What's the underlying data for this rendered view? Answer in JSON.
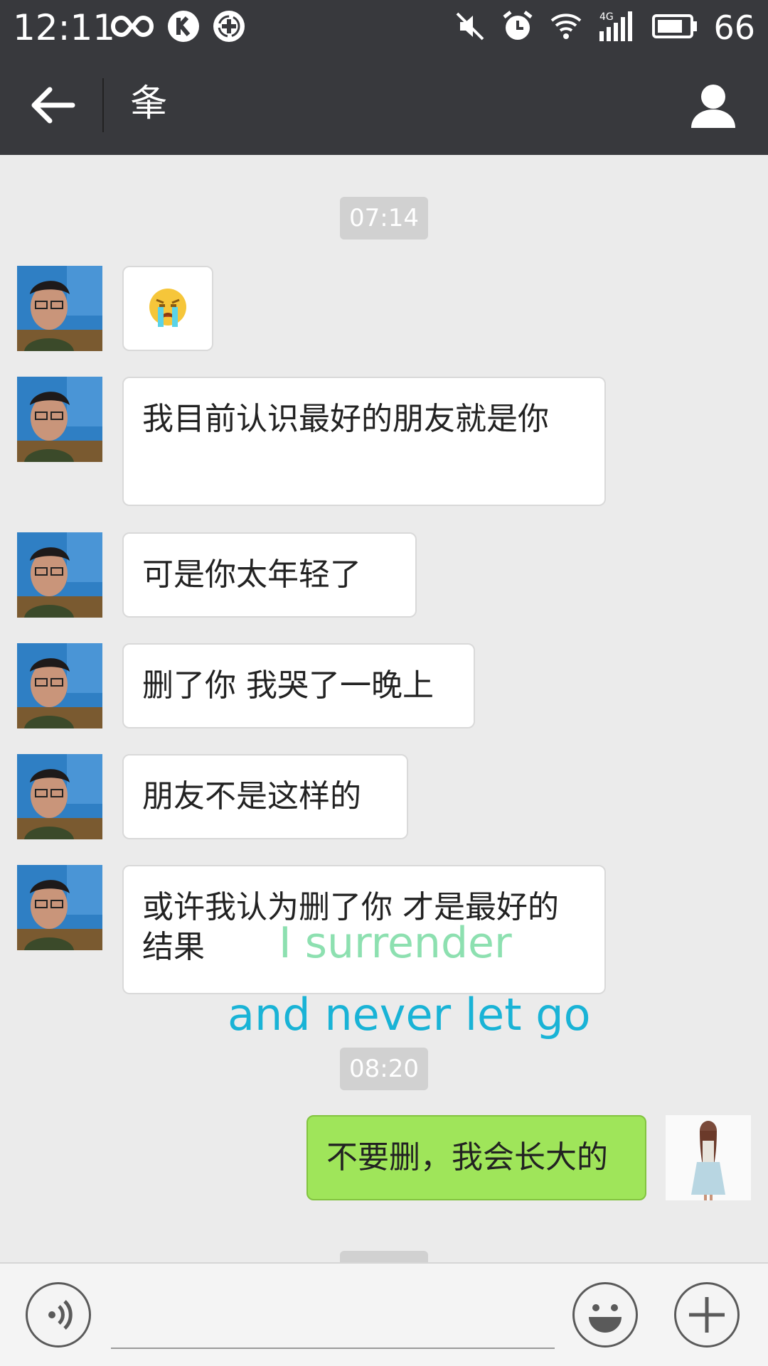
{
  "status_bar": {
    "time": "12:11",
    "battery": "66",
    "network": "4G"
  },
  "header": {
    "title": "夆"
  },
  "timestamps": [
    "07:14",
    "08:20"
  ],
  "messages": [
    {
      "from": "contact",
      "type": "emoji",
      "icon": "crying-face-emoji"
    },
    {
      "from": "contact",
      "text": " 我目前认识最好的朋友就是你"
    },
    {
      "from": "contact",
      "text": "可是你太年轻了"
    },
    {
      "from": "contact",
      "text": "删了你 我哭了一晚上"
    },
    {
      "from": "contact",
      "text": "朋友不是这样的"
    },
    {
      "from": "contact",
      "text": "或许我认为删了你 才是最好的结果"
    },
    {
      "from": "me",
      "text": "不要删，我会长大的"
    }
  ],
  "overlay": {
    "line1": "I surrender",
    "line2": "and never let go"
  },
  "colors": {
    "header_bg": "#38393d",
    "chat_bg": "#ebebeb",
    "self_bubble": "#9fe55a",
    "timestamp_bg": "#d1d1d1"
  }
}
